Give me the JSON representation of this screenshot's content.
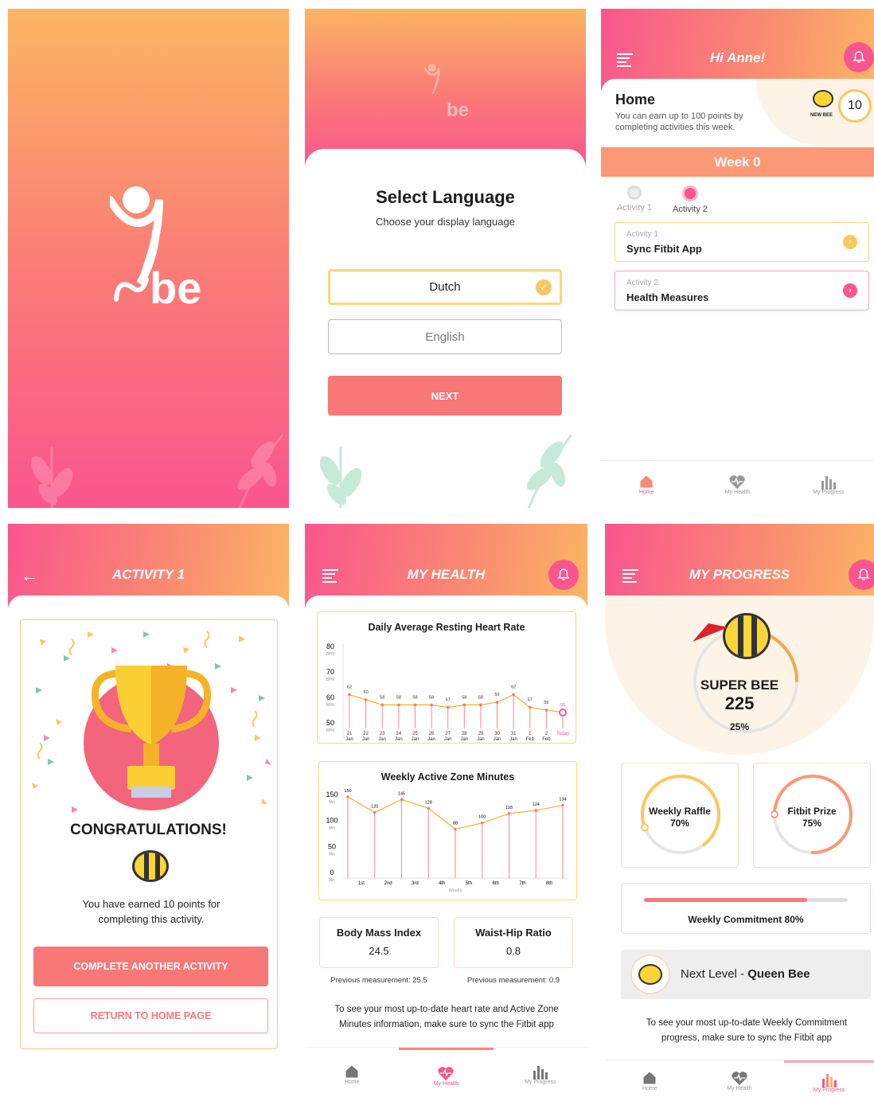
{
  "splash": {
    "logo_text": "be"
  },
  "language": {
    "title": "Select Language",
    "subtitle": "Choose your display language",
    "options": [
      "Dutch",
      "English"
    ],
    "next_label": "NEXT",
    "logo_text": "be"
  },
  "home": {
    "greeting": "Hi Anne!",
    "title": "Home",
    "description": "You can earn up to 100 points by completing activities this week.",
    "badge_label": "NEW BEE",
    "points": "10",
    "week_label": "Week 0",
    "steps": [
      "Activity 1",
      "Activity 2"
    ],
    "cards": [
      {
        "sub": "Activity 1",
        "title": "Sync Fitbit App"
      },
      {
        "sub": "Activity 2",
        "title": "Health Measures"
      }
    ],
    "nav": [
      "Home",
      "My Health",
      "My Progress"
    ]
  },
  "activity": {
    "title": "ACTIVITY 1",
    "congrats": "CONGRATULATIONS!",
    "message": "You have earned 10 points for completing this activity.",
    "primary_label": "COMPLETE ANOTHER ACTIVITY",
    "secondary_label": "RETURN TO HOME PAGE"
  },
  "health": {
    "title": "MY HEALTH",
    "nav": [
      "Home",
      "My Health",
      "My Progress"
    ],
    "bmi": {
      "title": "Body Mass Index",
      "value": "24.5",
      "previous": "Previous measurement: 25.5"
    },
    "whr": {
      "title": "Waist-Hip Ratio",
      "value": "0.8",
      "previous": "Previous measurement: 0.9"
    },
    "note": "To see your most up-to-date heart rate and Active Zone Minutes information, make sure to sync the Fitbit app"
  },
  "progress": {
    "title": "MY PROGRESS",
    "level_name": "SUPER BEE",
    "points": "225",
    "percent": "25%",
    "raffle": {
      "label": "Weekly Raffle",
      "value": "70%"
    },
    "prize": {
      "label": "Fitbit Prize",
      "value": "75%"
    },
    "commitment_label": "Weekly Commitment 80%",
    "next_prefix": "Next Level - ",
    "next_level": "Queen Bee",
    "note": "To see your most up-to-date Weekly Commitment progress, make sure to sync the Fitbit app",
    "nav": [
      "Home",
      "My Health",
      "My Progress"
    ]
  },
  "chart_data": [
    {
      "type": "line",
      "title": "Daily Average Resting Heart Rate",
      "y_ticks": [
        {
          "v": "80",
          "u": "BPM"
        },
        {
          "v": "70",
          "u": "BPM"
        },
        {
          "v": "60",
          "u": "BPM"
        },
        {
          "v": "50",
          "u": "BPM"
        }
      ],
      "ylim": [
        50,
        80
      ],
      "categories": [
        [
          "21",
          "Jan"
        ],
        [
          "22",
          "Jan"
        ],
        [
          "23",
          "Jan"
        ],
        [
          "24",
          "Jan"
        ],
        [
          "25",
          "Jan"
        ],
        [
          "26",
          "Jan"
        ],
        [
          "27",
          "Jan"
        ],
        [
          "28",
          "Jan"
        ],
        [
          "29",
          "Jan"
        ],
        [
          "30",
          "Jan"
        ],
        [
          "31",
          "Jan"
        ],
        [
          "1",
          "Feb"
        ],
        [
          "2",
          "Feb"
        ],
        [
          "Today",
          ""
        ]
      ],
      "values": [
        62,
        60,
        58,
        58,
        58,
        58,
        57,
        58,
        58,
        59,
        62,
        57,
        56,
        55
      ]
    },
    {
      "type": "line",
      "title": "Weekly Active Zone Minutes",
      "y_ticks": [
        {
          "v": "150",
          "u": "Min"
        },
        {
          "v": "100",
          "u": "Min"
        },
        {
          "v": "50",
          "u": "Min"
        },
        {
          "v": "0",
          "u": "Min"
        }
      ],
      "ylim": [
        0,
        150
      ],
      "categories": [
        "1st",
        "2nd",
        "3rd",
        "4th",
        "5th",
        "6th",
        "7th",
        "8th"
      ],
      "xlabel": "Weeks",
      "values": [
        150,
        120,
        145,
        128,
        88,
        100,
        118,
        124,
        134
      ]
    }
  ]
}
